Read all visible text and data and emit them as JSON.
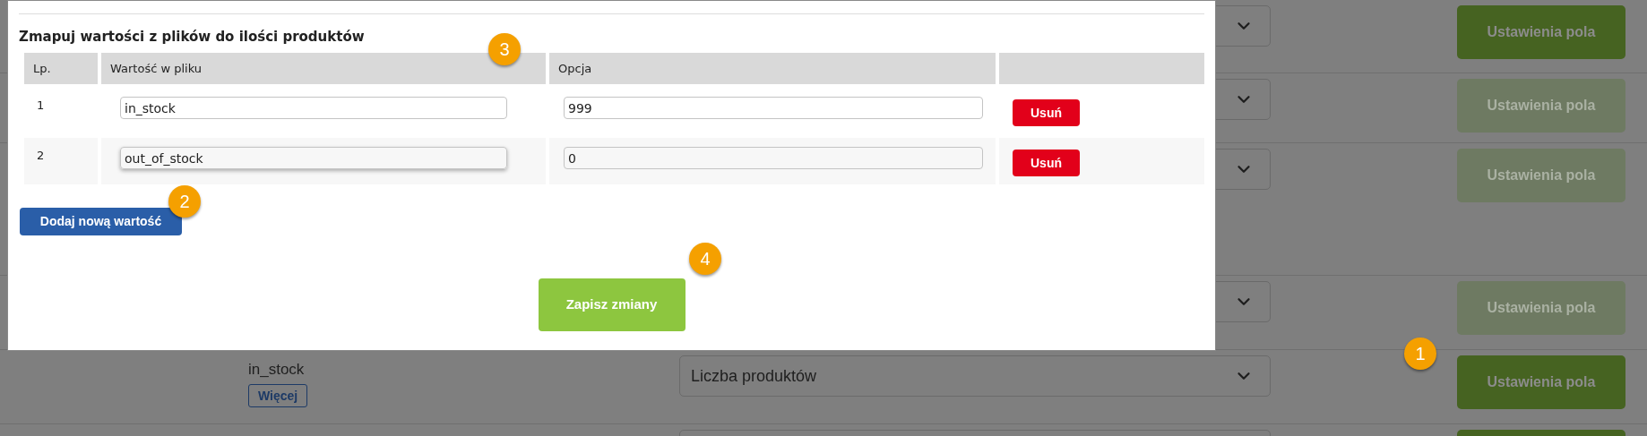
{
  "background_rows": [
    {
      "disabled": false,
      "button": "Ustawienia pola"
    },
    {
      "disabled": true,
      "button": "Ustawienia pola"
    },
    {
      "disabled": true,
      "button": "Ustawienia pola"
    },
    {
      "disabled": true,
      "button": "Ustawienia pola"
    },
    {
      "disabled": false,
      "button": "Ustawienia pola",
      "field_name": "in_stock",
      "more_button": "Więcej",
      "select_value": "Liczba produktów"
    },
    {
      "disabled": false
    }
  ],
  "modal": {
    "heading": "Zmapuj wartości z plików do ilości produktów",
    "columns": [
      "Lp.",
      "Wartość w pliku",
      "Opcja"
    ],
    "rows": [
      {
        "number": "1",
        "value": "in_stock",
        "option": "999",
        "delete_button": "Usuń",
        "focused": false
      },
      {
        "number": "2",
        "value": "out_of_stock",
        "option": "0",
        "delete_button": "Usuń",
        "focused": true
      }
    ],
    "add_button": "Dodaj nową wartość",
    "save_button": "Zapisz zmiany"
  },
  "badges": [
    {
      "label": "1"
    },
    {
      "label": "2"
    },
    {
      "label": "3"
    },
    {
      "label": "4"
    }
  ]
}
